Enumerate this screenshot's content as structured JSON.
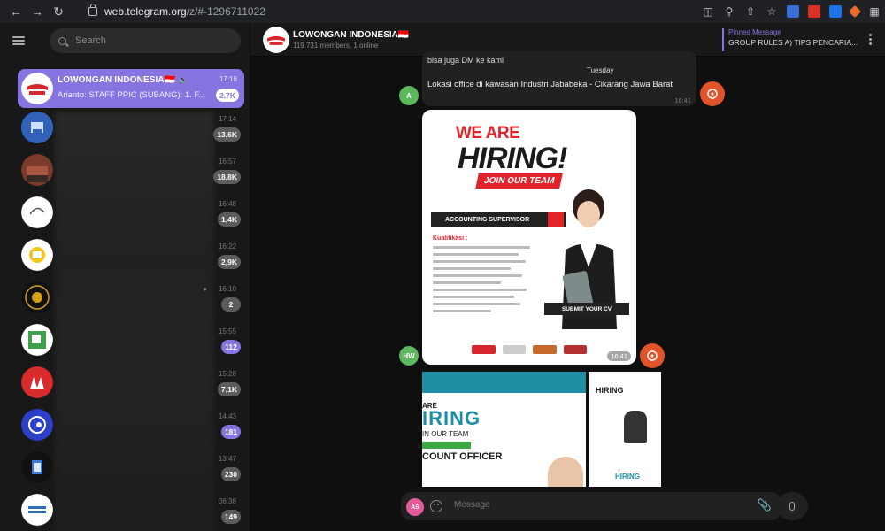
{
  "browser": {
    "url_host": "web.telegram.org",
    "url_path": "/z/#-1296711022"
  },
  "sidebar": {
    "search_placeholder": "Search",
    "active_chat": {
      "title": "LOWONGAN INDONESIA🇮🇩",
      "preview": "Arianto: STAFF PPIC (SUBANG): 1. F...",
      "time": "17:18",
      "badge": "2,7K"
    },
    "chats": [
      {
        "time": "17:14",
        "badge": "13,6K",
        "badge_style": "grey"
      },
      {
        "time": "16:57",
        "badge": "18,8K",
        "badge_style": "grey"
      },
      {
        "time": "16:48",
        "badge": "1,4K",
        "badge_style": "grey"
      },
      {
        "time": "16:22",
        "badge": "2,9K",
        "badge_style": "grey"
      },
      {
        "time": "16:10",
        "badge": "2",
        "badge_style": "grey"
      },
      {
        "time": "15:55",
        "badge": "112",
        "badge_style": "purple"
      },
      {
        "time": "15:28",
        "badge": "7,1K",
        "badge_style": "grey"
      },
      {
        "time": "14:43",
        "badge": "181",
        "badge_style": "purple"
      },
      {
        "time": "13:47",
        "badge": "230",
        "badge_style": "grey"
      },
      {
        "time": "06:38",
        "badge": "149",
        "badge_style": "grey"
      }
    ]
  },
  "chat": {
    "title": "LOWONGAN INDONESIA🇮🇩",
    "subtitle": "119 731 members, 1 online",
    "pinned_label": "Pinned Message",
    "pinned_text": "GROUP RULES A) TIPS PENCARIA...",
    "msg1_line1": "bisa juga DM ke kami",
    "date_separator": "Tuesday",
    "msg1_line2": "Lokasi office di kawasan Industri Jababeka - Cikarang Jawa Barat",
    "msg1_time": "16:41",
    "msg1_sender": "A",
    "poster_we": "WE ARE",
    "poster_hiring": "HIRING!",
    "poster_join": "JOIN OUR TEAM",
    "poster_position": "ACCOUNTING SUPERVISOR",
    "poster_kual": "Kualifikasi :",
    "poster_submit": "SUBMIT YOUR CV",
    "poster_time": "16:41",
    "poster_sender": "HW",
    "album_are": "ARE",
    "album_hiring": "IRING",
    "album_join": "IN OUR TEAM",
    "album_officer": "COUNT OFFICER",
    "album2_hiring": "HIRING",
    "album2_hiring2": "HIRING",
    "me_initials": "AS",
    "input_placeholder": "Message"
  },
  "colors": {
    "accent": "#8774e1",
    "forward_button": "#e0532b",
    "sender_green": "#5cb85c"
  }
}
